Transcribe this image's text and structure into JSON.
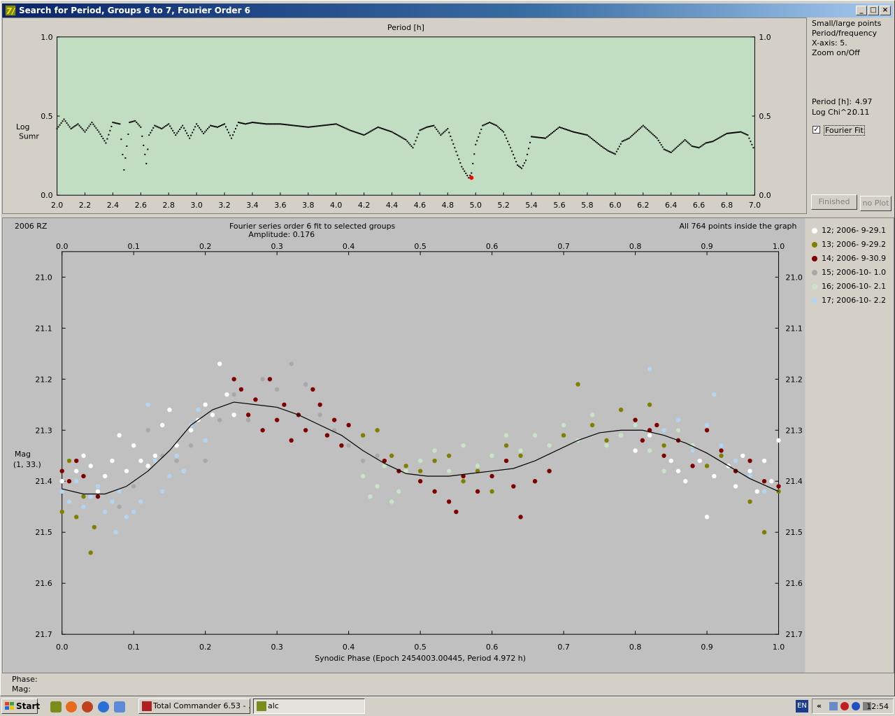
{
  "window": {
    "title": "Search for Period, Groups 6 to 7, Fourier Order 6",
    "app_icon": "7/"
  },
  "periodogram": {
    "title": "Period [h]",
    "ylabel": "Log Sumr",
    "minimum_period": 4.97
  },
  "sidepanel": {
    "lines": [
      "Small/large points",
      "Period/frequency",
      "X-axis: 5.",
      "Zoom on/Off"
    ],
    "period_label": "Period [h]:",
    "period_value": "4.97",
    "chi_label": "Log Chi^2:",
    "chi_value": "0.11",
    "fourier_fit_label": "Fourier Fit",
    "fourier_fit_checked": true,
    "finished_button": "Finished",
    "noplot_button": "no Plot"
  },
  "phaseplot": {
    "object": "2006 RZ",
    "title": "Fourier series order 6 fit to selected groups",
    "amplitude": "Amplitude: 0.176",
    "points_note": "All 764 points inside the graph",
    "xlabel": "Synodic Phase (Epoch 2454003.00445, Period 4.972 h)",
    "ylabel_line1": "Mag",
    "ylabel_line2": "(1, 33.)"
  },
  "legend": [
    {
      "label": "12; 2006- 9-29.1",
      "color": "#ffffff"
    },
    {
      "label": "13; 2006- 9-29.2",
      "color": "#808000"
    },
    {
      "label": "14; 2006- 9-30.9",
      "color": "#800000"
    },
    {
      "label": "15; 2006-10- 1.0",
      "color": "#a8a8a8"
    },
    {
      "label": "16; 2006-10- 2.1",
      "color": "#c8e4c8"
    },
    {
      "label": "17; 2006-10- 2.2",
      "color": "#b4d4f4"
    }
  ],
  "readout": {
    "phase_label": "Phase:",
    "mag_label": "Mag:"
  },
  "taskbar": {
    "start": "Start",
    "tasks": [
      {
        "label": "Total Commander 6.53 - ...",
        "active": false
      },
      {
        "label": "alc",
        "active": true
      }
    ],
    "lang": "EN",
    "clock": "12:54"
  },
  "chart_data": [
    {
      "type": "line",
      "title": "Period [h]",
      "xlabel": "",
      "ylabel": "Log Sumr",
      "xlim": [
        2.0,
        7.0
      ],
      "ylim": [
        0.0,
        1.0
      ],
      "xticks": [
        "2.0",
        "2.2",
        "2.4",
        "2.6",
        "2.8",
        "3.0",
        "3.2",
        "3.4",
        "3.6",
        "3.8",
        "4.0",
        "4.2",
        "4.4",
        "4.6",
        "4.8",
        "5.0",
        "5.2",
        "5.4",
        "5.6",
        "5.8",
        "6.0",
        "6.2",
        "6.4",
        "6.6",
        "6.8",
        "7.0"
      ],
      "yticks": [
        "0.0",
        "0.5",
        "1.0"
      ],
      "x": [
        2.0,
        2.05,
        2.1,
        2.15,
        2.2,
        2.25,
        2.3,
        2.35,
        2.4,
        2.45,
        2.48,
        2.52,
        2.56,
        2.6,
        2.64,
        2.66,
        2.7,
        2.75,
        2.8,
        2.85,
        2.9,
        2.95,
        3.0,
        3.05,
        3.1,
        3.15,
        3.2,
        3.25,
        3.3,
        3.35,
        3.4,
        3.5,
        3.6,
        3.7,
        3.8,
        3.9,
        4.0,
        4.1,
        4.2,
        4.3,
        4.4,
        4.5,
        4.55,
        4.6,
        4.65,
        4.7,
        4.75,
        4.8,
        4.85,
        4.9,
        4.95,
        4.97,
        5.0,
        5.05,
        5.1,
        5.15,
        5.2,
        5.25,
        5.3,
        5.33,
        5.36,
        5.4,
        5.5,
        5.6,
        5.7,
        5.8,
        5.9,
        5.95,
        6.0,
        6.05,
        6.1,
        6.2,
        6.3,
        6.35,
        6.4,
        6.5,
        6.55,
        6.6,
        6.65,
        6.7,
        6.8,
        6.9,
        6.95,
        7.0
      ],
      "y": [
        0.42,
        0.48,
        0.42,
        0.45,
        0.4,
        0.46,
        0.4,
        0.33,
        0.46,
        0.45,
        0.16,
        0.46,
        0.47,
        0.43,
        0.2,
        0.38,
        0.44,
        0.42,
        0.45,
        0.38,
        0.44,
        0.36,
        0.45,
        0.39,
        0.44,
        0.43,
        0.45,
        0.36,
        0.46,
        0.45,
        0.46,
        0.45,
        0.45,
        0.44,
        0.43,
        0.44,
        0.45,
        0.41,
        0.38,
        0.43,
        0.4,
        0.35,
        0.3,
        0.41,
        0.43,
        0.44,
        0.38,
        0.42,
        0.3,
        0.18,
        0.11,
        0.14,
        0.32,
        0.44,
        0.46,
        0.44,
        0.4,
        0.3,
        0.19,
        0.17,
        0.22,
        0.37,
        0.36,
        0.43,
        0.4,
        0.38,
        0.31,
        0.28,
        0.26,
        0.34,
        0.36,
        0.44,
        0.36,
        0.29,
        0.27,
        0.35,
        0.31,
        0.3,
        0.33,
        0.34,
        0.39,
        0.4,
        0.38,
        0.28
      ],
      "marker": {
        "x": 4.97,
        "y": 0.11,
        "color": "#ff0000"
      }
    },
    {
      "type": "scatter",
      "title": "Fourier series order 6 fit to selected groups",
      "xlabel": "Synodic Phase (Epoch 2454003.00445, Period 4.972 h)",
      "ylabel": "Mag",
      "xlim": [
        0.0,
        1.0
      ],
      "ylim": [
        21.7,
        20.95
      ],
      "xticks": [
        "0.0",
        "0.1",
        "0.2",
        "0.3",
        "0.4",
        "0.5",
        "0.6",
        "0.7",
        "0.8",
        "0.9",
        "1.0"
      ],
      "yticks": [
        "21.0",
        "21.1",
        "21.2",
        "21.3",
        "21.4",
        "21.5",
        "21.6",
        "21.7"
      ],
      "fit": {
        "name": "Fourier fit",
        "x": [
          0.0,
          0.03,
          0.06,
          0.09,
          0.12,
          0.15,
          0.18,
          0.21,
          0.24,
          0.27,
          0.3,
          0.33,
          0.36,
          0.39,
          0.42,
          0.45,
          0.48,
          0.51,
          0.54,
          0.57,
          0.6,
          0.63,
          0.66,
          0.69,
          0.72,
          0.75,
          0.78,
          0.81,
          0.84,
          0.87,
          0.9,
          0.93,
          0.96,
          1.0
        ],
        "y": [
          21.415,
          21.425,
          21.425,
          21.41,
          21.38,
          21.34,
          21.29,
          21.26,
          21.245,
          21.25,
          21.255,
          21.27,
          21.29,
          21.31,
          21.34,
          21.365,
          21.385,
          21.39,
          21.39,
          21.385,
          21.38,
          21.375,
          21.36,
          21.34,
          21.32,
          21.305,
          21.3,
          21.3,
          21.31,
          21.325,
          21.345,
          21.37,
          21.395,
          21.42
        ]
      },
      "series": [
        {
          "name": "12; 2006- 9-29.1",
          "color": "#ffffff",
          "x": [
            0.0,
            0.01,
            0.02,
            0.03,
            0.04,
            0.05,
            0.06,
            0.07,
            0.08,
            0.09,
            0.1,
            0.11,
            0.12,
            0.13,
            0.14,
            0.15,
            0.16,
            0.17,
            0.18,
            0.19,
            0.2,
            0.21,
            0.22,
            0.23,
            0.24,
            0.78,
            0.8,
            0.82,
            0.84,
            0.85,
            0.86,
            0.87,
            0.88,
            0.89,
            0.9,
            0.91,
            0.92,
            0.93,
            0.94,
            0.95,
            0.96,
            0.97,
            0.98,
            0.99,
            1.0
          ],
          "y": [
            21.4,
            21.36,
            21.38,
            21.35,
            21.37,
            21.42,
            21.39,
            21.36,
            21.31,
            21.38,
            21.33,
            21.36,
            21.37,
            21.35,
            21.29,
            21.26,
            21.33,
            21.38,
            21.3,
            21.28,
            21.25,
            21.27,
            21.17,
            21.23,
            21.27,
            21.31,
            21.34,
            21.31,
            21.35,
            21.36,
            21.38,
            21.4,
            21.33,
            21.36,
            21.47,
            21.39,
            21.34,
            21.37,
            21.41,
            21.35,
            21.38,
            21.42,
            21.36,
            21.4,
            21.32
          ]
        },
        {
          "name": "13; 2006- 9-29.2",
          "color": "#808000",
          "x": [
            0.0,
            0.01,
            0.02,
            0.03,
            0.04,
            0.045,
            0.42,
            0.44,
            0.46,
            0.48,
            0.5,
            0.52,
            0.54,
            0.56,
            0.58,
            0.6,
            0.62,
            0.64,
            0.66,
            0.68,
            0.7,
            0.72,
            0.74,
            0.76,
            0.78,
            0.8,
            0.82,
            0.84,
            0.86,
            0.88,
            0.9,
            0.92,
            0.94,
            0.96,
            0.98,
            1.0
          ],
          "y": [
            21.46,
            21.36,
            21.47,
            21.43,
            21.54,
            21.49,
            21.31,
            21.3,
            21.35,
            21.37,
            21.38,
            21.36,
            21.35,
            21.4,
            21.38,
            21.42,
            21.33,
            21.35,
            21.4,
            21.38,
            21.31,
            21.21,
            21.29,
            21.32,
            21.26,
            21.28,
            21.25,
            21.33,
            21.3,
            21.34,
            21.37,
            21.35,
            21.38,
            21.44,
            21.5,
            21.42
          ]
        },
        {
          "name": "14; 2006- 9-30.9",
          "color": "#800000",
          "x": [
            0.0,
            0.01,
            0.02,
            0.03,
            0.05,
            0.24,
            0.25,
            0.26,
            0.27,
            0.28,
            0.29,
            0.3,
            0.31,
            0.32,
            0.33,
            0.34,
            0.35,
            0.36,
            0.37,
            0.38,
            0.39,
            0.4,
            0.45,
            0.47,
            0.5,
            0.52,
            0.54,
            0.55,
            0.56,
            0.58,
            0.6,
            0.62,
            0.63,
            0.64,
            0.66,
            0.68,
            0.8,
            0.81,
            0.82,
            0.83,
            0.84,
            0.86,
            0.88,
            0.9,
            0.92,
            0.94,
            0.96,
            0.98,
            1.0
          ],
          "y": [
            21.38,
            21.4,
            21.36,
            21.39,
            21.43,
            21.2,
            21.22,
            21.27,
            21.24,
            21.3,
            21.2,
            21.28,
            21.25,
            21.32,
            21.27,
            21.3,
            21.22,
            21.25,
            21.31,
            21.28,
            21.33,
            21.29,
            21.36,
            21.38,
            21.4,
            21.42,
            21.44,
            21.46,
            21.39,
            21.42,
            21.39,
            21.36,
            21.41,
            21.47,
            21.4,
            21.38,
            21.28,
            21.32,
            21.3,
            21.29,
            21.35,
            21.32,
            21.37,
            21.3,
            21.34,
            21.38,
            21.36,
            21.4,
            21.41
          ]
        },
        {
          "name": "15; 2006-10- 1.0",
          "color": "#a8a8a8",
          "x": [
            0.08,
            0.1,
            0.12,
            0.14,
            0.16,
            0.18,
            0.2,
            0.22,
            0.24,
            0.26,
            0.28,
            0.3,
            0.32,
            0.34,
            0.36,
            0.38,
            0.4,
            0.42,
            0.44
          ],
          "y": [
            21.45,
            21.41,
            21.3,
            21.35,
            21.36,
            21.33,
            21.36,
            21.28,
            21.23,
            21.28,
            21.2,
            21.22,
            21.17,
            21.21,
            21.27,
            21.3,
            21.33,
            21.36,
            21.35
          ]
        },
        {
          "name": "16; 2006-10- 2.1",
          "color": "#c8e4c8",
          "x": [
            0.42,
            0.43,
            0.44,
            0.45,
            0.46,
            0.47,
            0.48,
            0.5,
            0.52,
            0.54,
            0.56,
            0.58,
            0.6,
            0.62,
            0.64,
            0.66,
            0.68,
            0.7,
            0.72,
            0.74,
            0.76,
            0.78,
            0.8,
            0.82,
            0.84,
            0.86,
            0.88
          ],
          "y": [
            21.39,
            21.43,
            21.41,
            21.37,
            21.44,
            21.42,
            21.38,
            21.36,
            21.34,
            21.38,
            21.33,
            21.37,
            21.35,
            21.31,
            21.34,
            21.31,
            21.33,
            21.29,
            21.32,
            21.27,
            21.33,
            21.31,
            21.29,
            21.34,
            21.38,
            21.3,
            21.33
          ]
        },
        {
          "name": "17; 2006-10- 2.2",
          "color": "#b4d4f4",
          "x": [
            0.0,
            0.01,
            0.02,
            0.03,
            0.04,
            0.05,
            0.06,
            0.07,
            0.075,
            0.08,
            0.09,
            0.1,
            0.11,
            0.12,
            0.13,
            0.14,
            0.15,
            0.16,
            0.17,
            0.18,
            0.19,
            0.2,
            0.82,
            0.84,
            0.86,
            0.88,
            0.9,
            0.91,
            0.92,
            0.94,
            0.96,
            0.98
          ],
          "y": [
            21.42,
            21.44,
            21.4,
            21.45,
            21.43,
            21.41,
            21.46,
            21.44,
            21.5,
            21.42,
            21.47,
            21.46,
            21.44,
            21.25,
            21.36,
            21.42,
            21.39,
            21.35,
            21.38,
            21.29,
            21.26,
            21.32,
            21.18,
            21.3,
            21.28,
            21.34,
            21.29,
            21.23,
            21.33,
            21.36,
            21.39,
            21.42
          ]
        }
      ]
    }
  ]
}
